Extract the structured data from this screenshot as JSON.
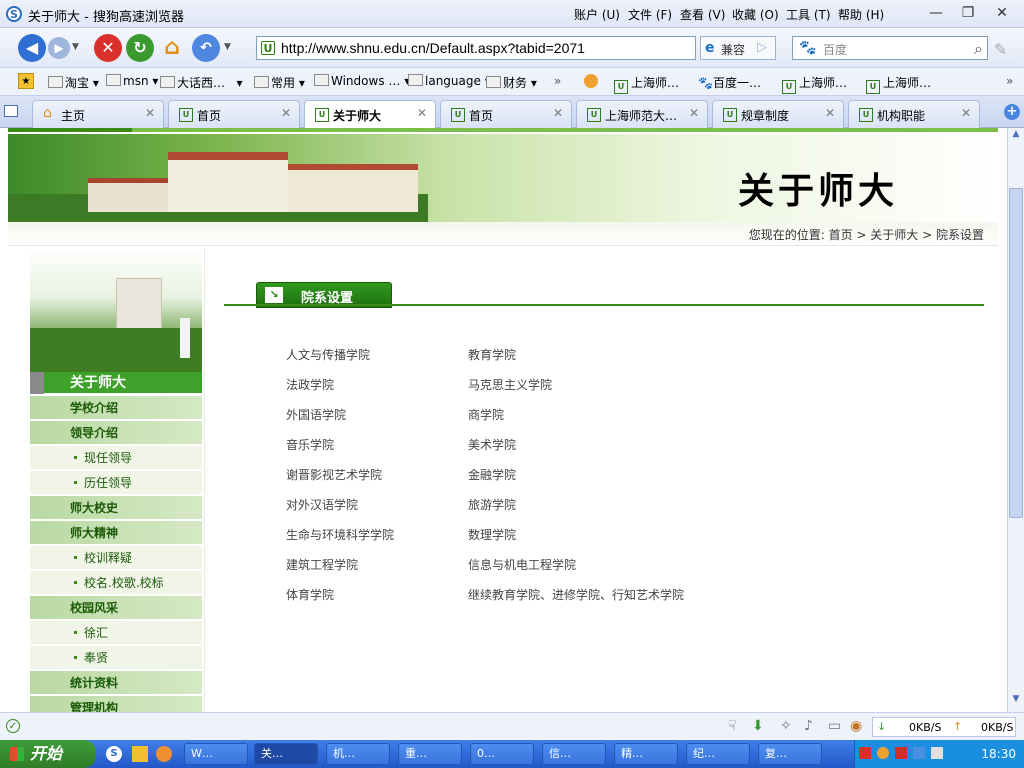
{
  "window": {
    "title": "关于师大 - 搜狗高速浏览器",
    "menus": [
      "账户 (U)",
      "文件 (F)",
      "查看 (V)",
      "收藏 (O)",
      "工具 (T)",
      "帮助 (H)"
    ]
  },
  "toolbar": {
    "url": "http://www.shnu.edu.cn/Default.aspx?tabid=2071",
    "compat_label": "兼容",
    "search_placeholder": "百度"
  },
  "bookmarks": [
    {
      "label": "淘宝"
    },
    {
      "label": "msn"
    },
    {
      "label": "大话西…"
    },
    {
      "label": "常用"
    },
    {
      "label": "Windows …"
    },
    {
      "label": "language"
    },
    {
      "label": "财务"
    },
    {
      "label": "上海师…"
    },
    {
      "label": "百度一…"
    },
    {
      "label": "上海师…"
    },
    {
      "label": "上海师…"
    }
  ],
  "tabs": [
    {
      "label": "主页",
      "active": false
    },
    {
      "label": "首页",
      "active": false
    },
    {
      "label": "关于师大",
      "active": true
    },
    {
      "label": "首页",
      "active": false
    },
    {
      "label": "上海师范大…",
      "active": false
    },
    {
      "label": "规章制度",
      "active": false
    },
    {
      "label": "机构职能",
      "active": false
    }
  ],
  "page": {
    "banner_title": "关于师大",
    "breadcrumb": "您现在的位置: 首页 > 关于师大 > 院系设置",
    "section_title": "院系设置",
    "sidebar": {
      "header": "关于师大",
      "items": [
        {
          "label": "学校介绍",
          "kind": "main"
        },
        {
          "label": "领导介绍",
          "kind": "main"
        },
        {
          "label": "现任领导",
          "kind": "sub"
        },
        {
          "label": "历任领导",
          "kind": "sub"
        },
        {
          "label": "师大校史",
          "kind": "main"
        },
        {
          "label": "师大精神",
          "kind": "main"
        },
        {
          "label": "校训释疑",
          "kind": "sub"
        },
        {
          "label": "校名.校歌.校标",
          "kind": "sub"
        },
        {
          "label": "校园风采",
          "kind": "main"
        },
        {
          "label": "徐汇",
          "kind": "sub"
        },
        {
          "label": "奉贤",
          "kind": "sub"
        },
        {
          "label": "统计资料",
          "kind": "main"
        },
        {
          "label": "管理机构",
          "kind": "main"
        }
      ]
    },
    "departments": {
      "left": [
        "人文与传播学院",
        "法政学院",
        "外国语学院",
        "音乐学院",
        "谢晋影视艺术学院",
        "对外汉语学院",
        "生命与环境科学学院",
        "建筑工程学院",
        "体育学院"
      ],
      "right": [
        "教育学院",
        "马克思主义学院",
        "商学院",
        "美术学院",
        "金融学院",
        "旅游学院",
        "数理学院",
        "信息与机电工程学院",
        "继续教育学院、进修学院、行知艺术学院"
      ]
    }
  },
  "statusbar": {
    "down_speed": "0KB/S",
    "up_speed": "0KB/S"
  },
  "taskbar": {
    "start_label": "开始",
    "tasks": [
      {
        "label": "W…"
      },
      {
        "label": "关…"
      },
      {
        "label": "机…"
      },
      {
        "label": "重…"
      },
      {
        "label": "0…"
      },
      {
        "label": "信…"
      },
      {
        "label": "精…"
      },
      {
        "label": "纪…"
      },
      {
        "label": "复…"
      }
    ],
    "clock": "18:30"
  }
}
